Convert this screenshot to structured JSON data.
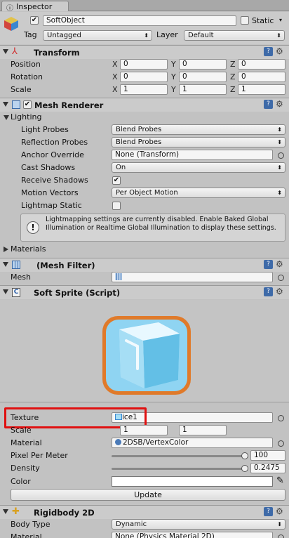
{
  "tab": {
    "label": "Inspector"
  },
  "object": {
    "name": "SoftObject",
    "static_label": "Static",
    "tag_label": "Tag",
    "tag_value": "Untagged",
    "layer_label": "Layer",
    "layer_value": "Default"
  },
  "transform": {
    "title": "Transform",
    "rows": [
      {
        "label": "Position",
        "x": "0",
        "y": "0",
        "z": "0"
      },
      {
        "label": "Rotation",
        "x": "0",
        "y": "0",
        "z": "0"
      },
      {
        "label": "Scale",
        "x": "1",
        "y": "1",
        "z": "1"
      }
    ],
    "axis": {
      "x": "X",
      "y": "Y",
      "z": "Z"
    }
  },
  "mesh_renderer": {
    "title": "Mesh Renderer",
    "lighting_label": "Lighting",
    "light_probes_label": "Light Probes",
    "light_probes_value": "Blend Probes",
    "reflection_probes_label": "Reflection Probes",
    "reflection_probes_value": "Blend Probes",
    "anchor_override_label": "Anchor Override",
    "anchor_override_value": "None (Transform)",
    "cast_shadows_label": "Cast Shadows",
    "cast_shadows_value": "On",
    "receive_shadows_label": "Receive Shadows",
    "motion_vectors_label": "Motion Vectors",
    "motion_vectors_value": "Per Object Motion",
    "lightmap_static_label": "Lightmap Static",
    "info_text": "Lightmapping settings are currently disabled. Enable Baked Global Illumination or Realtime Global Illumination to display these settings.",
    "materials_label": "Materials"
  },
  "mesh_filter": {
    "title": "(Mesh Filter)",
    "mesh_label": "Mesh"
  },
  "soft_sprite": {
    "title": "Soft Sprite (Script)",
    "texture_label": "Texture",
    "texture_value": "ice1",
    "scale_label": "Scale",
    "scale_x": "1",
    "scale_y": "1",
    "material_label": "Material",
    "material_value": "2DSB/VertexColor",
    "ppm_label": "Pixel Per Meter",
    "ppm_value": "100",
    "ppm_fraction": 1.0,
    "density_label": "Density",
    "density_value": "0.2475",
    "density_fraction": 1.0,
    "color_label": "Color",
    "update_label": "Update"
  },
  "rigidbody": {
    "title": "Rigidbody 2D",
    "body_type_label": "Body Type",
    "body_type_value": "Dynamic",
    "material_label": "Material",
    "material_value": "None (Physics Material 2D)"
  },
  "colors": {
    "highlight": "#e01010",
    "ice_blue": "#7fd0f0",
    "ice_border": "#e07a2a"
  }
}
